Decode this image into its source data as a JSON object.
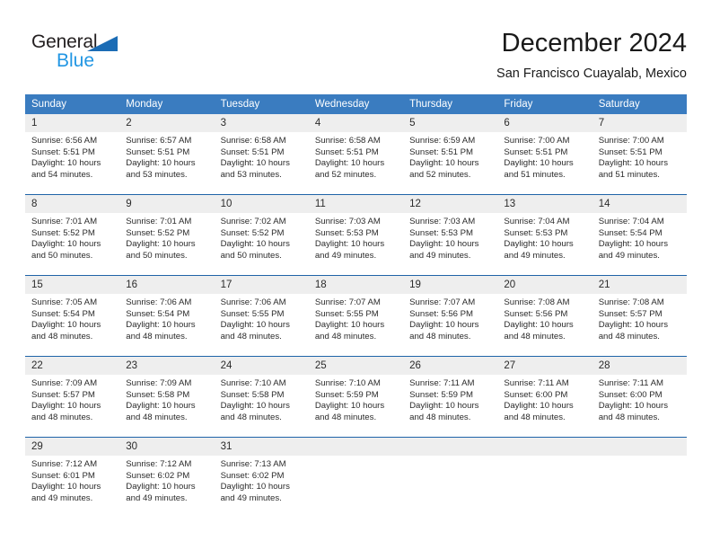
{
  "brand": {
    "name_part1": "General",
    "name_part2": "Blue",
    "triangle_icon": "triangle-icon",
    "accent_color": "#2196e3",
    "triangle_color": "#1b6cb5"
  },
  "header": {
    "title": "December 2024",
    "subtitle": "San Francisco Cuayalab, Mexico"
  },
  "theme": {
    "header_bg": "#3a7cc0",
    "row_divider": "#1f64a8",
    "daynum_bg": "#eeeeee",
    "text": "#2b2b2b"
  },
  "weekday_headers": [
    "Sunday",
    "Monday",
    "Tuesday",
    "Wednesday",
    "Thursday",
    "Friday",
    "Saturday"
  ],
  "weeks": [
    [
      {
        "day": "1",
        "sunrise": "Sunrise: 6:56 AM",
        "sunset": "Sunset: 5:51 PM",
        "daylight_line1": "Daylight: 10 hours",
        "daylight_line2": "and 54 minutes."
      },
      {
        "day": "2",
        "sunrise": "Sunrise: 6:57 AM",
        "sunset": "Sunset: 5:51 PM",
        "daylight_line1": "Daylight: 10 hours",
        "daylight_line2": "and 53 minutes."
      },
      {
        "day": "3",
        "sunrise": "Sunrise: 6:58 AM",
        "sunset": "Sunset: 5:51 PM",
        "daylight_line1": "Daylight: 10 hours",
        "daylight_line2": "and 53 minutes."
      },
      {
        "day": "4",
        "sunrise": "Sunrise: 6:58 AM",
        "sunset": "Sunset: 5:51 PM",
        "daylight_line1": "Daylight: 10 hours",
        "daylight_line2": "and 52 minutes."
      },
      {
        "day": "5",
        "sunrise": "Sunrise: 6:59 AM",
        "sunset": "Sunset: 5:51 PM",
        "daylight_line1": "Daylight: 10 hours",
        "daylight_line2": "and 52 minutes."
      },
      {
        "day": "6",
        "sunrise": "Sunrise: 7:00 AM",
        "sunset": "Sunset: 5:51 PM",
        "daylight_line1": "Daylight: 10 hours",
        "daylight_line2": "and 51 minutes."
      },
      {
        "day": "7",
        "sunrise": "Sunrise: 7:00 AM",
        "sunset": "Sunset: 5:51 PM",
        "daylight_line1": "Daylight: 10 hours",
        "daylight_line2": "and 51 minutes."
      }
    ],
    [
      {
        "day": "8",
        "sunrise": "Sunrise: 7:01 AM",
        "sunset": "Sunset: 5:52 PM",
        "daylight_line1": "Daylight: 10 hours",
        "daylight_line2": "and 50 minutes."
      },
      {
        "day": "9",
        "sunrise": "Sunrise: 7:01 AM",
        "sunset": "Sunset: 5:52 PM",
        "daylight_line1": "Daylight: 10 hours",
        "daylight_line2": "and 50 minutes."
      },
      {
        "day": "10",
        "sunrise": "Sunrise: 7:02 AM",
        "sunset": "Sunset: 5:52 PM",
        "daylight_line1": "Daylight: 10 hours",
        "daylight_line2": "and 50 minutes."
      },
      {
        "day": "11",
        "sunrise": "Sunrise: 7:03 AM",
        "sunset": "Sunset: 5:53 PM",
        "daylight_line1": "Daylight: 10 hours",
        "daylight_line2": "and 49 minutes."
      },
      {
        "day": "12",
        "sunrise": "Sunrise: 7:03 AM",
        "sunset": "Sunset: 5:53 PM",
        "daylight_line1": "Daylight: 10 hours",
        "daylight_line2": "and 49 minutes."
      },
      {
        "day": "13",
        "sunrise": "Sunrise: 7:04 AM",
        "sunset": "Sunset: 5:53 PM",
        "daylight_line1": "Daylight: 10 hours",
        "daylight_line2": "and 49 minutes."
      },
      {
        "day": "14",
        "sunrise": "Sunrise: 7:04 AM",
        "sunset": "Sunset: 5:54 PM",
        "daylight_line1": "Daylight: 10 hours",
        "daylight_line2": "and 49 minutes."
      }
    ],
    [
      {
        "day": "15",
        "sunrise": "Sunrise: 7:05 AM",
        "sunset": "Sunset: 5:54 PM",
        "daylight_line1": "Daylight: 10 hours",
        "daylight_line2": "and 48 minutes."
      },
      {
        "day": "16",
        "sunrise": "Sunrise: 7:06 AM",
        "sunset": "Sunset: 5:54 PM",
        "daylight_line1": "Daylight: 10 hours",
        "daylight_line2": "and 48 minutes."
      },
      {
        "day": "17",
        "sunrise": "Sunrise: 7:06 AM",
        "sunset": "Sunset: 5:55 PM",
        "daylight_line1": "Daylight: 10 hours",
        "daylight_line2": "and 48 minutes."
      },
      {
        "day": "18",
        "sunrise": "Sunrise: 7:07 AM",
        "sunset": "Sunset: 5:55 PM",
        "daylight_line1": "Daylight: 10 hours",
        "daylight_line2": "and 48 minutes."
      },
      {
        "day": "19",
        "sunrise": "Sunrise: 7:07 AM",
        "sunset": "Sunset: 5:56 PM",
        "daylight_line1": "Daylight: 10 hours",
        "daylight_line2": "and 48 minutes."
      },
      {
        "day": "20",
        "sunrise": "Sunrise: 7:08 AM",
        "sunset": "Sunset: 5:56 PM",
        "daylight_line1": "Daylight: 10 hours",
        "daylight_line2": "and 48 minutes."
      },
      {
        "day": "21",
        "sunrise": "Sunrise: 7:08 AM",
        "sunset": "Sunset: 5:57 PM",
        "daylight_line1": "Daylight: 10 hours",
        "daylight_line2": "and 48 minutes."
      }
    ],
    [
      {
        "day": "22",
        "sunrise": "Sunrise: 7:09 AM",
        "sunset": "Sunset: 5:57 PM",
        "daylight_line1": "Daylight: 10 hours",
        "daylight_line2": "and 48 minutes."
      },
      {
        "day": "23",
        "sunrise": "Sunrise: 7:09 AM",
        "sunset": "Sunset: 5:58 PM",
        "daylight_line1": "Daylight: 10 hours",
        "daylight_line2": "and 48 minutes."
      },
      {
        "day": "24",
        "sunrise": "Sunrise: 7:10 AM",
        "sunset": "Sunset: 5:58 PM",
        "daylight_line1": "Daylight: 10 hours",
        "daylight_line2": "and 48 minutes."
      },
      {
        "day": "25",
        "sunrise": "Sunrise: 7:10 AM",
        "sunset": "Sunset: 5:59 PM",
        "daylight_line1": "Daylight: 10 hours",
        "daylight_line2": "and 48 minutes."
      },
      {
        "day": "26",
        "sunrise": "Sunrise: 7:11 AM",
        "sunset": "Sunset: 5:59 PM",
        "daylight_line1": "Daylight: 10 hours",
        "daylight_line2": "and 48 minutes."
      },
      {
        "day": "27",
        "sunrise": "Sunrise: 7:11 AM",
        "sunset": "Sunset: 6:00 PM",
        "daylight_line1": "Daylight: 10 hours",
        "daylight_line2": "and 48 minutes."
      },
      {
        "day": "28",
        "sunrise": "Sunrise: 7:11 AM",
        "sunset": "Sunset: 6:00 PM",
        "daylight_line1": "Daylight: 10 hours",
        "daylight_line2": "and 48 minutes."
      }
    ],
    [
      {
        "day": "29",
        "sunrise": "Sunrise: 7:12 AM",
        "sunset": "Sunset: 6:01 PM",
        "daylight_line1": "Daylight: 10 hours",
        "daylight_line2": "and 49 minutes."
      },
      {
        "day": "30",
        "sunrise": "Sunrise: 7:12 AM",
        "sunset": "Sunset: 6:02 PM",
        "daylight_line1": "Daylight: 10 hours",
        "daylight_line2": "and 49 minutes."
      },
      {
        "day": "31",
        "sunrise": "Sunrise: 7:13 AM",
        "sunset": "Sunset: 6:02 PM",
        "daylight_line1": "Daylight: 10 hours",
        "daylight_line2": "and 49 minutes."
      },
      {
        "day": "",
        "sunrise": "",
        "sunset": "",
        "daylight_line1": "",
        "daylight_line2": ""
      },
      {
        "day": "",
        "sunrise": "",
        "sunset": "",
        "daylight_line1": "",
        "daylight_line2": ""
      },
      {
        "day": "",
        "sunrise": "",
        "sunset": "",
        "daylight_line1": "",
        "daylight_line2": ""
      },
      {
        "day": "",
        "sunrise": "",
        "sunset": "",
        "daylight_line1": "",
        "daylight_line2": ""
      }
    ]
  ]
}
